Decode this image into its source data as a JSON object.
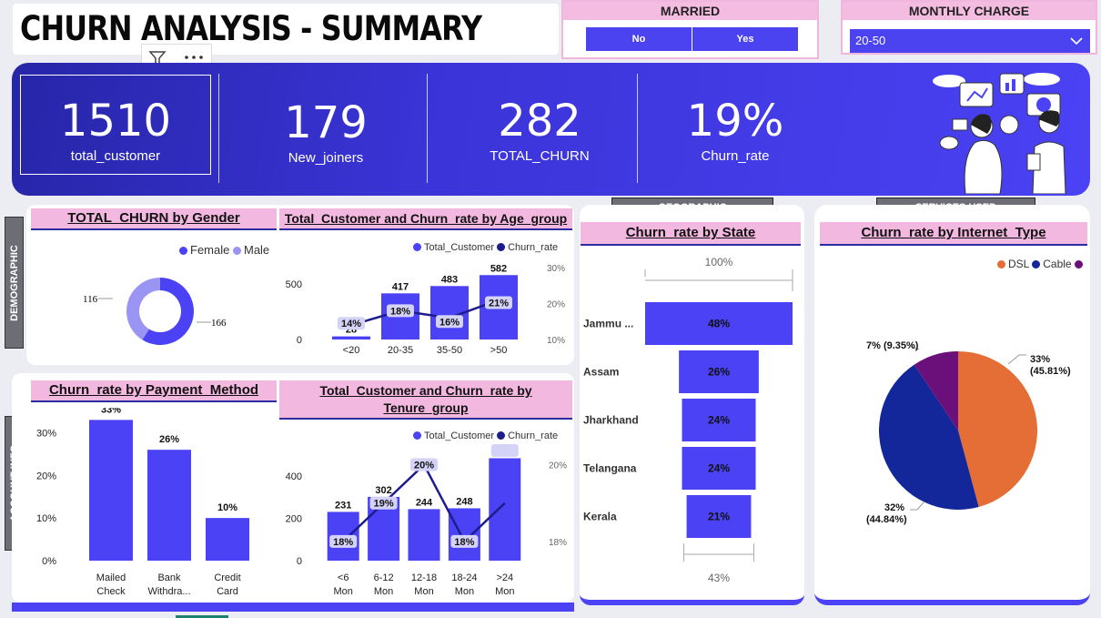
{
  "header": {
    "title": "CHURN ANALYSIS - SUMMARY"
  },
  "slicers": {
    "married": {
      "title": "MARRIED",
      "options": [
        "No",
        "Yes"
      ]
    },
    "monthly_charge": {
      "title": "MONTHLY CHARGE",
      "selected": "20-50"
    }
  },
  "kpis": [
    {
      "value": "1510",
      "label": "total_customer"
    },
    {
      "value": "179",
      "label": "New_joiners"
    },
    {
      "value": "282",
      "label": "TOTAL_CHURN"
    },
    {
      "value": "19%",
      "label": "Churn_rate"
    }
  ],
  "sections": {
    "demographic": "DEMOGRAPHIC",
    "account_info": "ACCOUNT INFO",
    "geographic": "GEOGRAPHIC",
    "services_used": "SERVICES USED"
  },
  "chart_titles": {
    "gender": "TOTAL_CHURN by Gender",
    "age": "Total_Customer and Churn_rate by Age_group",
    "payment": "Churn_rate by Payment_Method",
    "tenure_line1": "Total_Customer and Churn_rate by",
    "tenure_line2": "Tenure_group",
    "state": "Churn_rate by State",
    "internet": "Churn_rate by Internet_Type"
  },
  "colors": {
    "primary": "#4a42f4",
    "male": "#9a95f2",
    "line": "#1c1c8c",
    "dsl": "#e46e36",
    "cable": "#13279a",
    "other": "#6b0f7a",
    "pink": "#f3b8df"
  },
  "chart_data": [
    {
      "type": "pie",
      "id": "gender",
      "legend": [
        "Female",
        "Male"
      ],
      "labels": [
        "166",
        "116"
      ],
      "values": [
        166,
        116
      ]
    },
    {
      "type": "bar",
      "id": "age",
      "legend": [
        "Total_Customer",
        "Churn_rate"
      ],
      "categories": [
        "<20",
        "20-35",
        "35-50",
        ">50"
      ],
      "series": [
        {
          "name": "Total_Customer",
          "values": [
            28,
            417,
            483,
            582
          ]
        },
        {
          "name": "Churn_rate",
          "values": [
            14,
            18,
            16,
            21
          ],
          "labels": [
            "14%",
            "18%",
            "16%",
            "21%"
          ]
        }
      ],
      "y_ticks": [
        "0",
        "500"
      ],
      "y2_ticks": [
        "10%",
        "20%",
        "30%"
      ],
      "ylim": [
        0,
        650
      ],
      "y2lim": [
        10,
        30
      ]
    },
    {
      "type": "bar",
      "id": "payment",
      "categories": [
        [
          "Mailed",
          "Check"
        ],
        [
          "Bank",
          "Withdra..."
        ],
        [
          "Credit",
          "Card"
        ]
      ],
      "values": [
        33,
        26,
        10
      ],
      "labels": [
        "33%",
        "26%",
        "10%"
      ],
      "y_ticks": [
        "0%",
        "10%",
        "20%",
        "30%"
      ],
      "ylim": [
        0,
        35
      ]
    },
    {
      "type": "bar",
      "id": "tenure",
      "legend": [
        "Total_Customer",
        "Churn_rate"
      ],
      "categories": [
        [
          "<6",
          "Mon"
        ],
        [
          "6-12",
          "Mon"
        ],
        [
          "12-18",
          "Mon"
        ],
        [
          "18-24",
          "Mon"
        ],
        [
          ">24",
          "Mon"
        ]
      ],
      "series": [
        {
          "name": "Total_Customer",
          "values": [
            231,
            302,
            244,
            248,
            485
          ]
        },
        {
          "name": "Churn_rate",
          "values": [
            18,
            19,
            20,
            18,
            19
          ],
          "labels": [
            "18%",
            "19%",
            "20%",
            "18%",
            "19%"
          ]
        }
      ],
      "y_ticks": [
        "0",
        "200",
        "400"
      ],
      "y2_ticks": [
        "18%",
        "20%"
      ],
      "ylim": [
        0,
        500
      ],
      "y2lim": [
        17.5,
        20.25
      ]
    },
    {
      "type": "bar",
      "id": "state",
      "top_label": "100%",
      "bottom_label": "43%",
      "categories": [
        "Jammu ...",
        "Assam",
        "Jharkhand",
        "Telangana",
        "Kerala"
      ],
      "values": [
        48,
        26,
        24,
        24,
        21
      ],
      "labels": [
        "48%",
        "26%",
        "24%",
        "24%",
        "21%"
      ]
    },
    {
      "type": "pie",
      "id": "internet",
      "legend": [
        "DSL",
        "Cable"
      ],
      "labels": [
        "33%\n(45.81%)",
        "32%\n(44.84%)",
        "7% (9.35%)"
      ],
      "values": [
        45.81,
        44.84,
        9.35
      ]
    }
  ]
}
